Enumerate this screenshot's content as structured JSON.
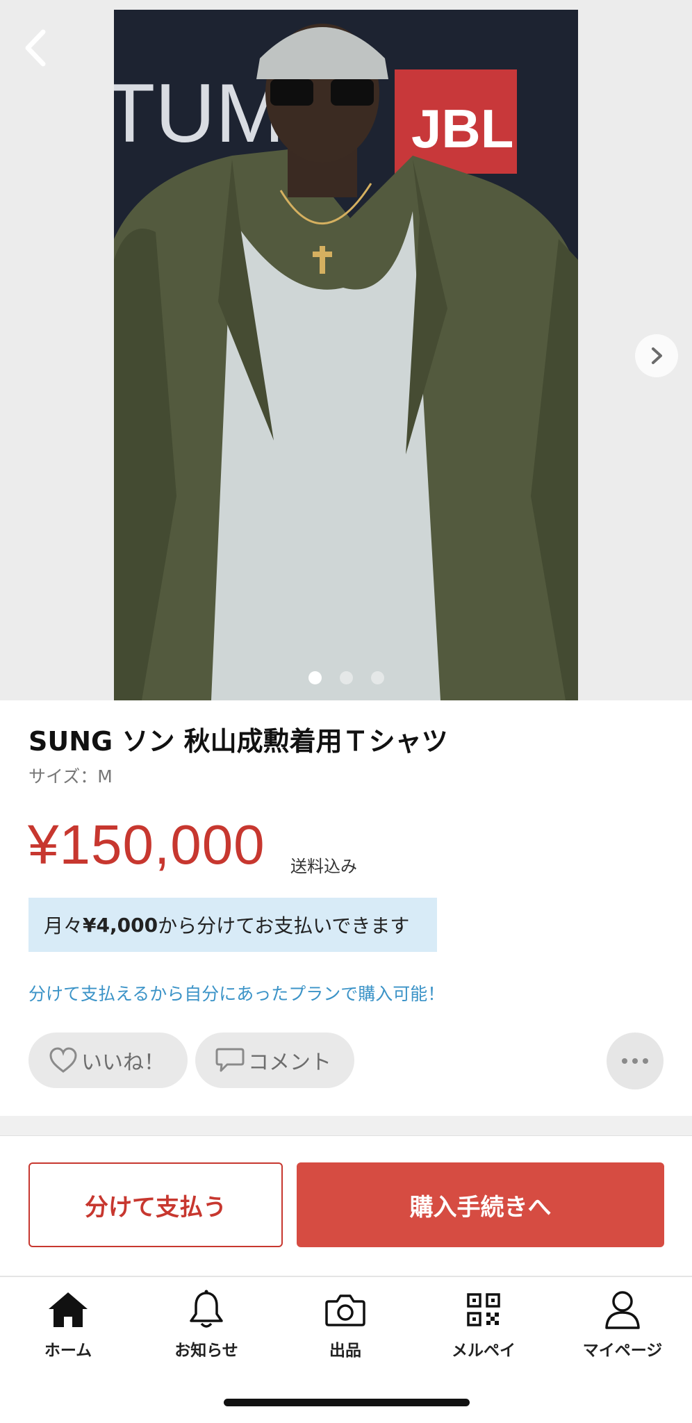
{
  "item": {
    "title": "SUNG ソン 秋山成勲着用Ｔシャツ",
    "size": "サイズ：M",
    "price": "¥150,000",
    "shipping": "送料込み"
  },
  "installment": {
    "prefix": "月々",
    "amount": "¥4,000",
    "suffix": " から分けてお支払いできます",
    "plan_link": "分けて支払えるから自分にあったプランで購入可能！"
  },
  "gallery": {
    "image_count": 3,
    "active_index": 0
  },
  "photo_text": {
    "brand_left": "TUM",
    "brand_right": "JBL"
  },
  "actions": {
    "like_label": "いいね！",
    "comment_label": "コメント",
    "split_pay_label": "分けて支払う",
    "purchase_label": "購入手続きへ"
  },
  "tabbar": {
    "items": [
      {
        "label": "ホーム",
        "icon": "home-icon"
      },
      {
        "label": "お知らせ",
        "icon": "bell-icon"
      },
      {
        "label": "出品",
        "icon": "camera-icon"
      },
      {
        "label": "メルペイ",
        "icon": "qr-code-icon"
      },
      {
        "label": "マイページ",
        "icon": "person-icon"
      }
    ]
  },
  "colors": {
    "accent": "#c7372f",
    "buy_button": "#d64c42",
    "installment_bg": "#d8ebf7",
    "link": "#3b93c7"
  }
}
